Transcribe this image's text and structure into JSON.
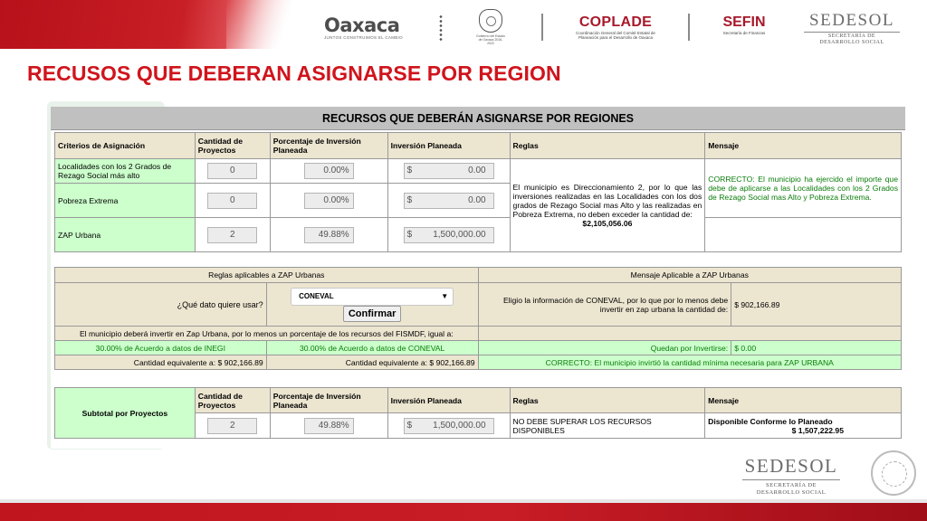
{
  "header": {
    "oaxaca_logo": "Oaxaca",
    "oaxaca_tagline": "JUNTOS CONSTRUIMOS EL CAMBIO",
    "escudo_caption": "Gobierno del Estado de Oaxaca 2016-2022",
    "coplade_logo": "COPLADE",
    "coplade_sub": "Coordinación General del Comité Estatal de Planeación para el Desarrollo de Oaxaca",
    "sefin_logo": "SEFIN",
    "sefin_sub": "Secretaría de Finanzas",
    "sedesol_logo": "SEDESOL",
    "sedesol_sub1": "SECRETARÍA DE",
    "sedesol_sub2": "DESARROLLO SOCIAL"
  },
  "slide_title": "RECUSOS QUE DEBERAN ASIGNARSE POR REGION",
  "panel": {
    "title": "RECURSOS QUE DEBERÁN ASIGNARSE POR REGIONES",
    "columns": [
      "Criterios de Asignación",
      "Cantidad de Proyectos",
      "Porcentaje de Inversión Planeada",
      "Inversión Planeada",
      "Reglas",
      "Mensaje"
    ],
    "rows": [
      {
        "criterio": "Localidades con los 2 Grados de Rezago Social más alto",
        "cantidad": "0",
        "porcentaje": "0.00%",
        "currency": "$",
        "inversion": "0.00"
      },
      {
        "criterio": "Pobreza Extrema",
        "cantidad": "0",
        "porcentaje": "0.00%",
        "currency": "$",
        "inversion": "0.00"
      },
      {
        "criterio": "ZAP Urbana",
        "cantidad": "2",
        "porcentaje": "49.88%",
        "currency": "$",
        "inversion": "1,500,000.00"
      }
    ],
    "reglas_text": "El municipio es Direccionamiento 2, por lo que las inversiones realizadas en las Localidades con los dos grados de Rezago Social mas Alto y las realizadas en Pobreza Extrema, no deben exceder la cantidad de:",
    "reglas_amount": "$2,105,056.06",
    "mensaje_text": "CORRECTO: El municipio ha ejercido el importe que debe de aplicarse a las Localidades con los 2 Grados de Rezago Social mas Alto y Pobreza Extrema."
  },
  "zap": {
    "reglas_header": "Reglas aplicables a ZAP Urbanas",
    "mensaje_header": "Mensaje Aplicable a ZAP Urbanas",
    "question": "¿Qué dato quiere usar?",
    "select_value": "CONEVAL",
    "confirm_label": "Confirmar",
    "invest_text": "El municipio deberá invertir en Zap Urbana, por lo menos un porcentaje de los recursos del FISMDF, igual a:",
    "inegi_text": "30.00% de Acuerdo a datos de INEGI",
    "coneval_text": "30.00% de Acuerdo a datos de CONEVAL",
    "equiv_label": "Cantidad equivalente a:",
    "equiv_inegi": "$ 902,166.89",
    "equiv_coneval": "$ 902,166.89",
    "elige_text": "Eligio la información de CONEVAL, por lo que por lo menos debe invertir en zap urbana la cantidad de:",
    "elige_amount": "$ 902,166.89",
    "quedan_label": "Quedan por Invertirse:",
    "quedan_amount": "$ 0.00",
    "correcto_text": "CORRECTO: El municipio invirtió la cantidad mínima necesaria para ZAP URBANA"
  },
  "subtotal": {
    "label": "Subtotal por Proyectos",
    "columns": [
      "Cantidad de Proyectos",
      "Porcentaje de Inversión Planeada",
      "Inversión Planeada",
      "Reglas",
      "Mensaje"
    ],
    "cantidad": "2",
    "porcentaje": "49.88%",
    "currency": "$",
    "inversion": "1,500,000.00",
    "reglas": "NO DEBE SUPERAR LOS RECURSOS DISPONIBLES",
    "mensaje": "Disponible Conforme lo Planeado",
    "mensaje_amount": "$ 1,507,222.95"
  },
  "footer": {
    "sedesol_logo": "SEDESOL",
    "sedesol_sub1": "SECRETARÍA DE",
    "sedesol_sub2": "DESARROLLO SOCIAL"
  },
  "colors": {
    "title_red": "#d0141c",
    "green_cell": "#ccffcc",
    "header_beige": "#ece5d0",
    "ok_green": "#0a7d0a"
  }
}
